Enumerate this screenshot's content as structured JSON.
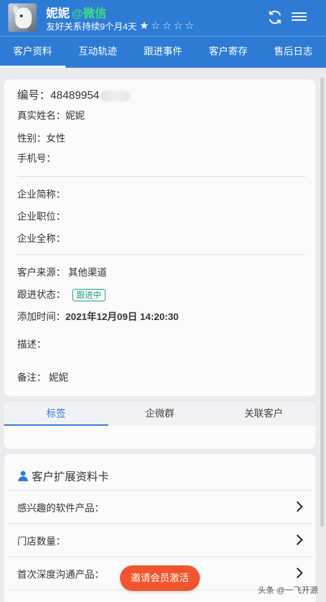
{
  "header": {
    "name": "妮妮",
    "source": "@微信",
    "relation": "友好关系持续9个月4天",
    "rating": 1,
    "rating_max": 5
  },
  "tabs": [
    "客户资料",
    "互动轨迹",
    "跟进事件",
    "客户寄存",
    "售后日志"
  ],
  "active_tab": 0,
  "profile": {
    "id_label": "编号：",
    "id_value": "48489954",
    "real_name_label": "真实姓名：",
    "real_name_value": "妮妮",
    "gender_label": "性别：",
    "gender_value": "女性",
    "phone_label": "手机号：",
    "phone_value": "",
    "company_short_label": "企业简称：",
    "company_position_label": "企业职位：",
    "company_full_label": "企业全称：",
    "source_label": "客户来源：",
    "source_value": "其他渠道",
    "follow_label": "跟进状态：",
    "follow_badge": "跟进中",
    "added_label": "添加时间：",
    "added_value": "2021年12月09日 14:20:30",
    "desc_label": "描述：",
    "remark_label": "备注：",
    "remark_value": "妮妮"
  },
  "subtabs": [
    "标签",
    "企微群",
    "关联客户"
  ],
  "active_subtab": 0,
  "extension": {
    "title": "客户扩展资料卡",
    "fields": [
      "感兴趣的软件产品：",
      "门店数量：",
      "首次深度沟通产品："
    ]
  },
  "activate_button": "邀请会员激活",
  "watermark": "头条 @一飞开源",
  "colors": {
    "primary": "#2e7bd6",
    "wechat": "#3ddc84",
    "badge": "#1aa07a",
    "action": "#f0562d"
  }
}
